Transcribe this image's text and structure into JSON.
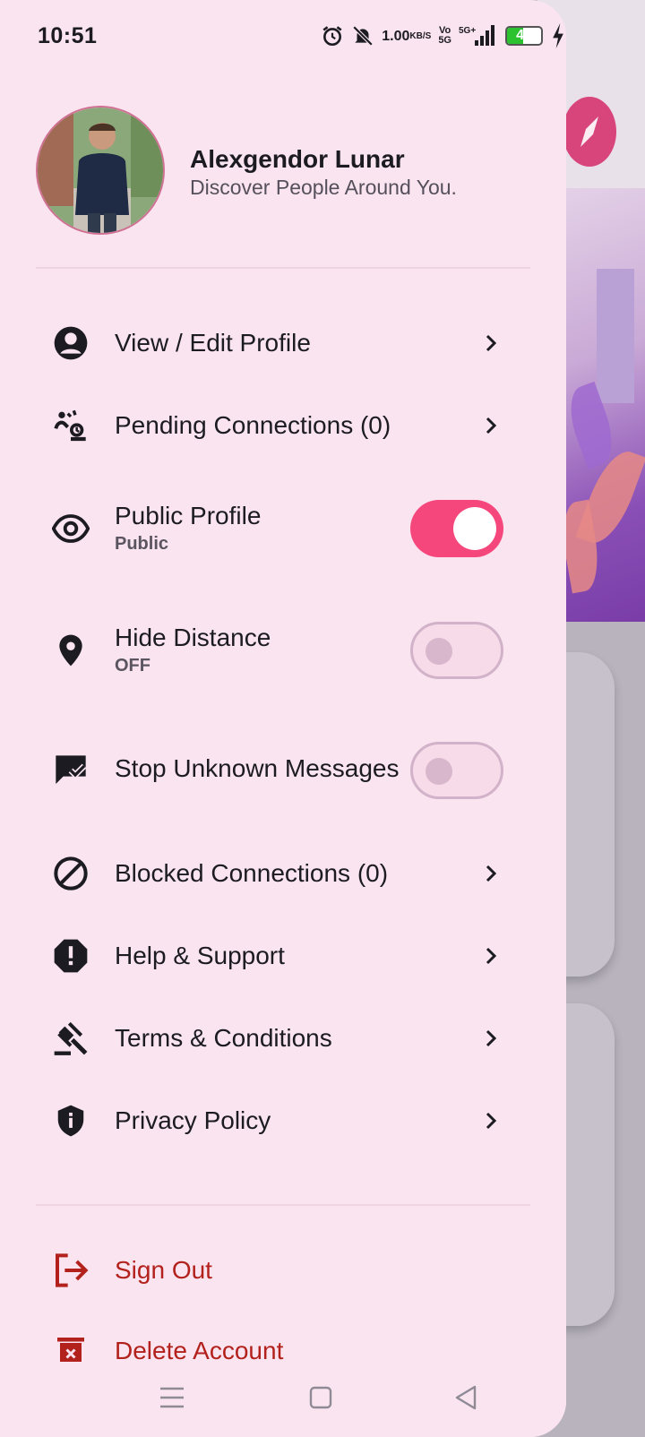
{
  "status_bar": {
    "time": "10:51",
    "net_speed": "1.00",
    "net_unit": "KB/S",
    "vo_top": "Vo",
    "vo_bottom": "5G",
    "network": "5G+",
    "battery_level": "47",
    "battery_fraction": 0.47
  },
  "profile": {
    "name": "Alexgendor Lunar",
    "tagline": "Discover People Around You."
  },
  "menu": {
    "view_edit_profile": "View / Edit Profile",
    "pending_connections": "Pending Connections (0)",
    "public_profile": {
      "label": "Public Profile",
      "sub": "Public",
      "on": true
    },
    "hide_distance": {
      "label": "Hide Distance",
      "sub": "OFF",
      "on": false
    },
    "stop_unknown_messages": {
      "label": "Stop Unknown Messages",
      "on": false
    },
    "blocked_connections": "Blocked Connections (0)",
    "help_support": "Help & Support",
    "terms_conditions": "Terms & Conditions",
    "privacy_policy": "Privacy Policy"
  },
  "account": {
    "sign_out": "Sign Out",
    "delete_account": "Delete Account"
  },
  "colors": {
    "drawer_bg": "#f9e4ef",
    "accent": "#f6477d",
    "danger": "#b3211c",
    "text": "#1c1b22"
  },
  "icons": [
    "alarm-icon",
    "mute-bell-icon",
    "signal-icon",
    "battery-icon",
    "charging-icon",
    "account-circle-icon",
    "pending-connections-icon",
    "eye-icon",
    "location-pin-icon",
    "message-check-icon",
    "block-icon",
    "alert-octagon-icon",
    "gavel-icon",
    "shield-info-icon",
    "logout-icon",
    "delete-icon",
    "chevron-right-icon",
    "compass-icon"
  ]
}
